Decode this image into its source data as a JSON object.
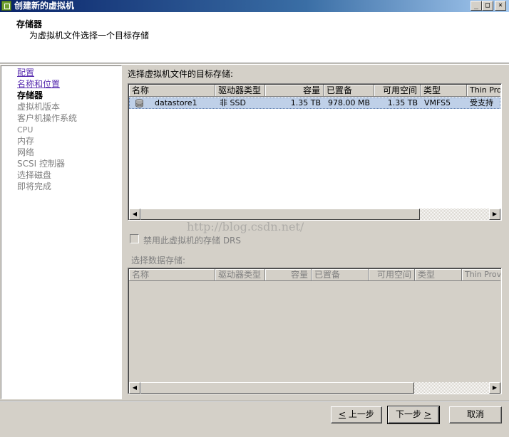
{
  "window": {
    "title": "创建新的虚拟机",
    "minimize_glyph": "_",
    "maximize_glyph": "□",
    "close_glyph": "×"
  },
  "header": {
    "title": "存储器",
    "subtitle": "为虚拟机文件选择一个目标存储"
  },
  "sidebar": {
    "items": [
      {
        "label": "配置",
        "state": "link"
      },
      {
        "label": "名称和位置",
        "state": "link"
      },
      {
        "label": "存储器",
        "state": "current"
      },
      {
        "label": "虚拟机版本",
        "state": "pending"
      },
      {
        "label": "客户机操作系统",
        "state": "pending"
      },
      {
        "label": "CPU",
        "state": "disabled"
      },
      {
        "label": "内存",
        "state": "pending"
      },
      {
        "label": "网络",
        "state": "pending"
      },
      {
        "label": "SCSI 控制器",
        "state": "pending"
      },
      {
        "label": "选择磁盘",
        "state": "pending"
      },
      {
        "label": "即将完成",
        "state": "pending"
      }
    ]
  },
  "main": {
    "section_label": "选择虚拟机文件的目标存储:",
    "columns": [
      "名称",
      "驱动器类型",
      "容量",
      "已置备",
      "可用空间",
      "类型",
      "Thin Provi"
    ],
    "rows": [
      {
        "name": "datastore1",
        "drive_type": "非 SSD",
        "capacity": "1.35 TB",
        "provisioned": "978.00 MB",
        "free": "1.35 TB",
        "type": "VMFS5",
        "thin": "受支持"
      }
    ],
    "drs_checkbox_label": "禁用此虚拟机的存储 DRS",
    "drs_checked": false,
    "datastore_label": "选择数据存储:",
    "datastore_columns": [
      "名称",
      "驱动器类型",
      "容量",
      "已置备",
      "可用空间",
      "类型",
      "Thin Provi"
    ]
  },
  "watermark": "http://blog.csdn.net/",
  "footer": {
    "back": {
      "hotkey": "<",
      "label": " 上一步"
    },
    "next": {
      "label": "下一步 ",
      "hotkey": ">"
    },
    "cancel": "取消"
  },
  "colors": {
    "link": "#5a2fb0",
    "selection": "#bfd0e8",
    "titlebar": "#0a246a"
  },
  "icons": {
    "app": "vsphere-icon",
    "datastore": "database-icon"
  }
}
